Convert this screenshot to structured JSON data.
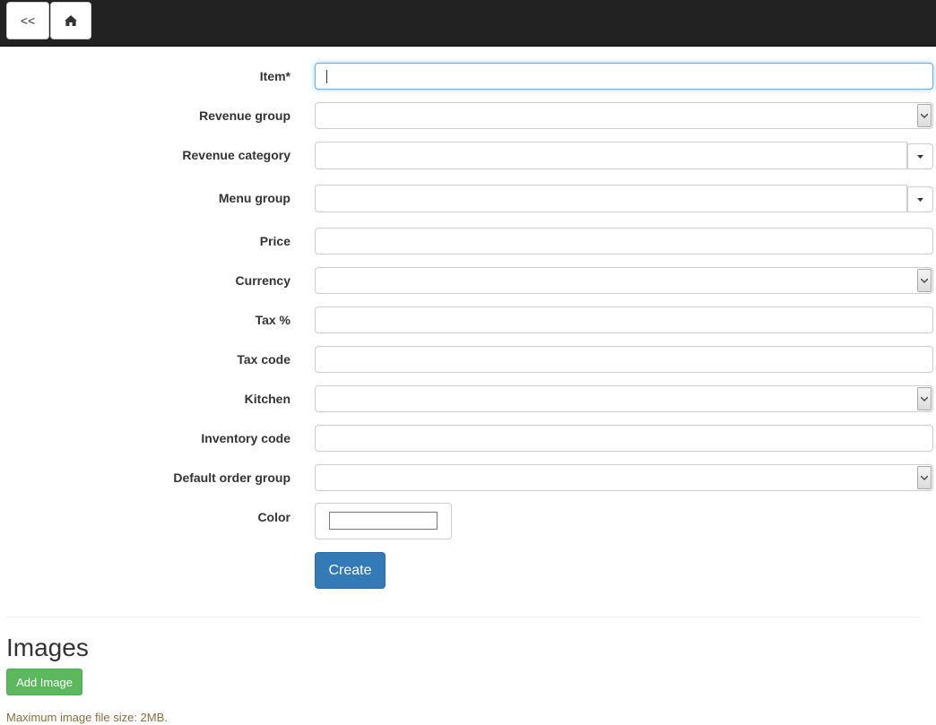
{
  "nav": {
    "back_label": "<<",
    "home_icon": "home-icon"
  },
  "form": {
    "item_label": "Item*",
    "revenue_group_label": "Revenue group",
    "revenue_category_label": "Revenue category",
    "menu_group_label": "Menu group",
    "price_label": "Price",
    "currency_label": "Currency",
    "tax_percent_label": "Tax %",
    "tax_code_label": "Tax code",
    "kitchen_label": "Kitchen",
    "inventory_code_label": "Inventory code",
    "default_order_group_label": "Default order group",
    "color_label": "Color",
    "color_value": "#ffffff",
    "create_label": "Create"
  },
  "images": {
    "heading": "Images",
    "add_label": "Add Image",
    "note": "Maximum image file size: 2MB."
  },
  "colors": {
    "topbar": "#222222",
    "primary": "#337ab7",
    "success": "#5cb85c",
    "warning_text": "#8a6d3b",
    "focus": "#66afe9"
  }
}
